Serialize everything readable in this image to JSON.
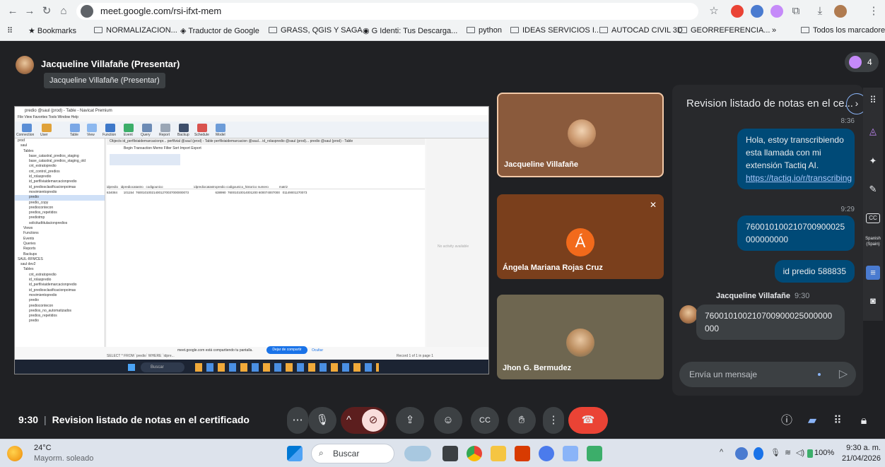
{
  "browser": {
    "url": "meet.google.com/rsi-ifxt-mem",
    "bookmarks": [
      "Bookmarks",
      "NORMALIZACION...",
      "Traductor de Google",
      "GRASS, QGIS Y SAGA",
      "Identi: Tus Descarga...",
      "python",
      "IDEAS SERVICIOS I...",
      "AUTOCAD CIVIL 3D",
      "GEORREFERENCIA...",
      "»",
      "Todos los marcadores"
    ]
  },
  "presenter": {
    "title": "Jacqueline Villafañe (Presentar)",
    "tooltip": "Jacqueline Villafañe (Presentar)"
  },
  "people_count": "4",
  "shared_screen": {
    "window_title": "predio @saul (prod) - Table - Navicat Premium",
    "menu": "File   View   Favorites   Tools   Window   Help",
    "toolbar": [
      "Connection",
      "User",
      "Table",
      "View",
      "Function",
      "Event",
      "Query",
      "Report",
      "Backup",
      "Schedule",
      "Model"
    ],
    "tabs": "Objects   id_perfilviaidemarcacionpr...   perfilvial @saul (prod) - Table   perfilviaidemarcacion @saul...   id_rolaspredio @saul (prod)...   predio @saul (prod) - Table",
    "actions": "Begin Transaction    Memo    Filter    Sort    Import    Export",
    "tree": [
      "prod",
      "saul",
      "Tables",
      "base_catastral_predios_staging",
      "base_catastral_predios_staging_old",
      "cnt_estratopredio",
      "cnt_control_predios",
      "id_rolaspredio",
      "id_perfilviaidemarcacionpredio",
      "id_prediosclasificacionpoimas",
      "movimientopredio",
      "predio",
      "predio_copy",
      "prediocontecon",
      "predios_repetidos",
      "prediotmp",
      "solicitudtitulacionpredios",
      "Views",
      "Functions",
      "Events",
      "Queries",
      "Reports",
      "Backups",
      "SAUL-RFMCES",
      "saul dev2",
      "Tables",
      "cnt_estratopredio",
      "id_rolaspredio",
      "id_perfilviaidemarcacionpredio",
      "id_prediosclasificacionpoimas",
      "movimientopredio",
      "predio",
      "prediocontecon",
      "predios_no_automatizados",
      "predios_repetidos",
      "predio"
    ],
    "columns": "idpredio   idprediocatastro   codigounico                                   idprediocatastropredio codigounico_historico numero            matriz",
    "row": "634084       101154  760010100214001270037000000073                              638990  76001010014001200 600074007000   01149001270073",
    "right_hint": "No activity available",
    "status_sql": "SELECT * FROM `predio` WHERE `idpre...",
    "sharing_msg": "meet.google.com está compartiendo tu pantalla.",
    "stop_share": "Dejar de compartir",
    "hide": "Ocultar",
    "record": "Record 1 of 1 in page 1"
  },
  "tiles": [
    {
      "name": "Jacqueline Villafañe"
    },
    {
      "name": "Ángela Mariana Rojas Cruz",
      "initial": "Á"
    },
    {
      "name": "Jhon G. Bermudez"
    }
  ],
  "chat": {
    "title": "Revision listado de notas en el ce...",
    "messages": [
      {
        "time": "8:36",
        "text": "Hola, estoy transcribiendo esta llamada con mi extensión Tactiq AI.",
        "link": "https://tactiq.io/r/transcribing"
      },
      {
        "time": "9:29",
        "text": "760010100210700900025000000000"
      },
      {
        "text": "id predio 588835"
      }
    ],
    "incoming": {
      "sender": "Jacqueline Villafañe",
      "time": "9:30",
      "text": "760010100210700900025000000000"
    },
    "input_placeholder": "Envía un mensaje"
  },
  "side_rail": {
    "cc": "CC",
    "language": "Spanish (Spain)"
  },
  "meeting": {
    "time": "9:30",
    "title": "Revision listado de notas en el certificado"
  },
  "taskbar": {
    "temperature": "24°C",
    "weather": "Mayorm. soleado",
    "search_placeholder": "Buscar",
    "battery": "100%",
    "time": "9:30 a. m.",
    "date": "21/04/2026"
  },
  "colors": {
    "accent": "#1a73e8",
    "end_call": "#ea4335",
    "camera_off": "#f9dedc",
    "chat_bubble": "#004a77",
    "tile1": "#8a5a3c",
    "tile2": "#7a3f1c",
    "tile3": "#6e6650"
  }
}
